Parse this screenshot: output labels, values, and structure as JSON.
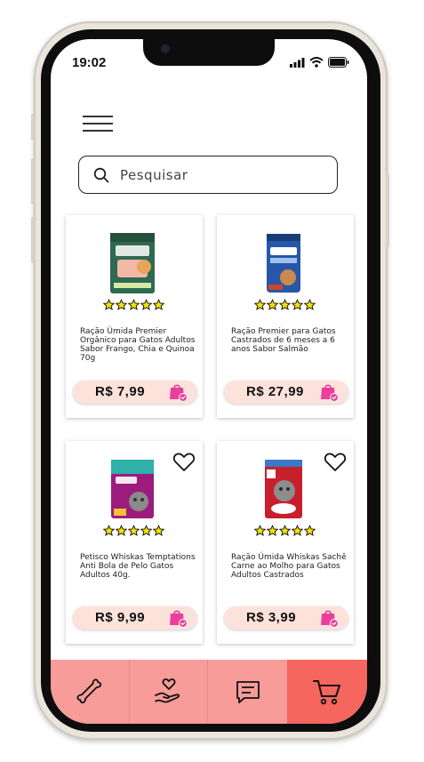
{
  "status_bar": {
    "time": "19:02"
  },
  "search": {
    "placeholder": "Pesquisar"
  },
  "products": [
    {
      "name": "Ração Úmida Premier Orgânico para Gatos Adultos Sabor Frango, Chia e Quinoa 70g",
      "price": "R$ 7,99",
      "rating": 5,
      "image": "premier-organico-pouch",
      "favorite_icon": false
    },
    {
      "name": "Ração Premier para Gatos Castrados de 6 meses a 6 anos Sabor Salmão",
      "price": "R$ 27,99",
      "rating": 5,
      "image": "premier-gatos-bag",
      "favorite_icon": false
    },
    {
      "name": "Petisco Whiskas Temptations Anti Bola de Pelo Gatos Adultos 40g.",
      "price": "R$ 9,99",
      "rating": 5,
      "image": "whiskas-temptations-pack",
      "favorite_icon": true
    },
    {
      "name": "Ração Úmida Whiskas Sachê Carne ao Molho para Gatos Adultos Castrados",
      "price": "R$ 3,99",
      "rating": 5,
      "image": "whiskas-sache-pouch",
      "favorite_icon": true
    }
  ],
  "bottom_nav": [
    {
      "icon": "bone-icon"
    },
    {
      "icon": "heart-hand-icon"
    },
    {
      "icon": "chat-icon"
    },
    {
      "icon": "cart-icon"
    }
  ],
  "colors": {
    "accent": "#f79c98",
    "accent_active": "#f4665e",
    "price_pill": "#fde2dc",
    "bag_pink": "#ea3f9a",
    "star_yellow": "#f5e400"
  }
}
